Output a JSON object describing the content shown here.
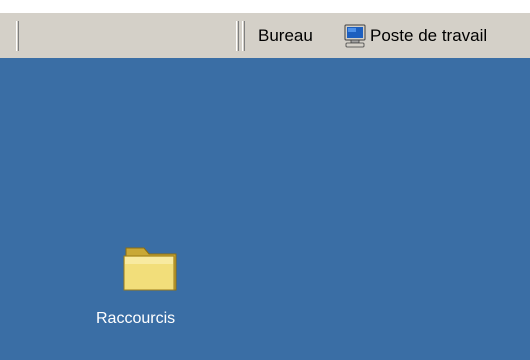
{
  "taskbar": {
    "bureau_label": "Bureau",
    "poste_label": "Poste de travail",
    "poste_icon": "computer-icon"
  },
  "desktop": {
    "background": "#3a6ea5",
    "icons": [
      {
        "label": "Raccourcis",
        "icon": "folder-icon"
      }
    ]
  }
}
